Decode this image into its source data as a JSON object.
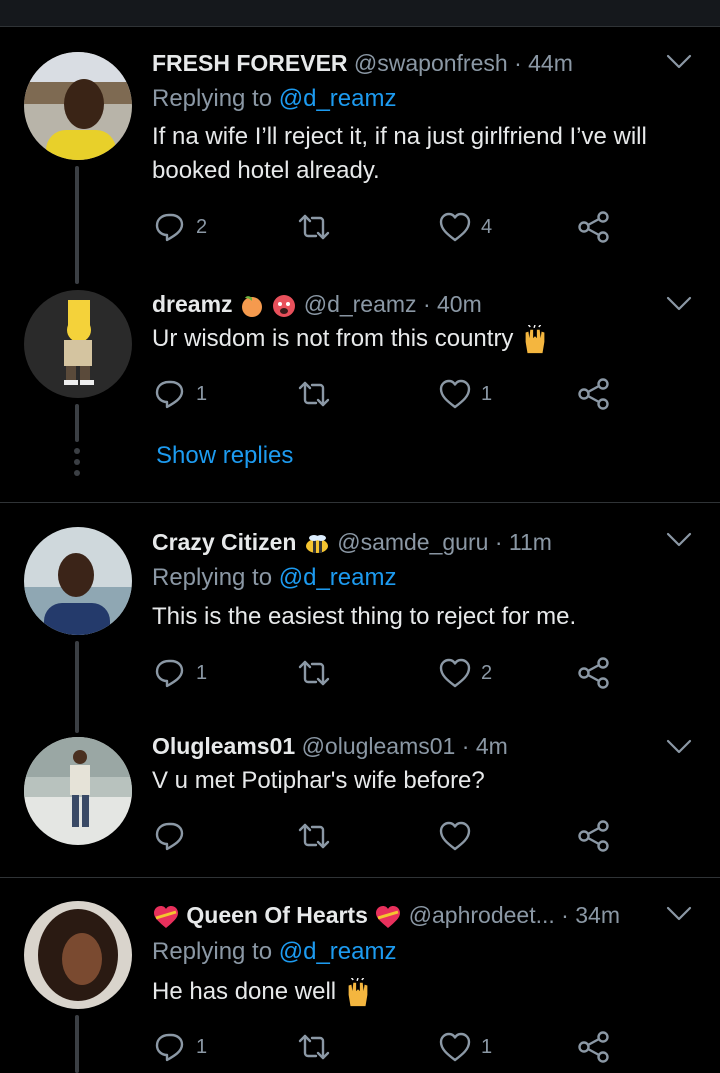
{
  "tweets": [
    {
      "name": "FRESH FOREVER",
      "handle": "@swaponfresh",
      "sep": "·",
      "time": "44m",
      "replying_prefix": "Replying to",
      "replying_to": "@d_reamz",
      "text": "If na wife I’ll reject it, if na just girlfriend I’ve will booked hotel already.",
      "reply_count": "2",
      "retweet_count": "",
      "like_count": "4"
    },
    {
      "name": "dreamz",
      "name_emojis": [
        "peach-emoji",
        "hot-face-emoji"
      ],
      "handle": "@d_reamz",
      "sep": "·",
      "time": "40m",
      "text": "Ur wisdom is not from this country",
      "text_emoji": "raised-hands-emoji",
      "reply_count": "1",
      "retweet_count": "",
      "like_count": "1"
    },
    {
      "name": "Crazy Citizen",
      "name_emoji": "bee-emoji",
      "handle": "@samde_guru",
      "sep": "·",
      "time": "11m",
      "replying_prefix": "Replying to",
      "replying_to": "@d_reamz",
      "text": "This is the easiest thing to reject for me.",
      "reply_count": "1",
      "retweet_count": "",
      "like_count": "2"
    },
    {
      "name": "Olugleams01",
      "handle": "@olugleams01",
      "sep": "·",
      "time": "4m",
      "text": "V u met Potiphar's wife before?",
      "reply_count": "",
      "retweet_count": "",
      "like_count": ""
    },
    {
      "name": "Queen Of Hearts",
      "name_emojis": [
        "heart-with-ribbon-emoji",
        "heart-with-ribbon-emoji"
      ],
      "handle": "@aphrodeet...",
      "sep": "·",
      "time": "34m",
      "replying_prefix": "Replying to",
      "replying_to": "@d_reamz",
      "text": "He has done well",
      "text_emoji": "raised-hands-emoji",
      "reply_count": "1",
      "retweet_count": "",
      "like_count": "1"
    }
  ],
  "show_replies": "Show replies",
  "colors": {
    "background": "#000000",
    "text": "#e7e9ea",
    "muted": "#8b98a5",
    "link": "#1d9bf0",
    "divider": "#2f3336"
  }
}
